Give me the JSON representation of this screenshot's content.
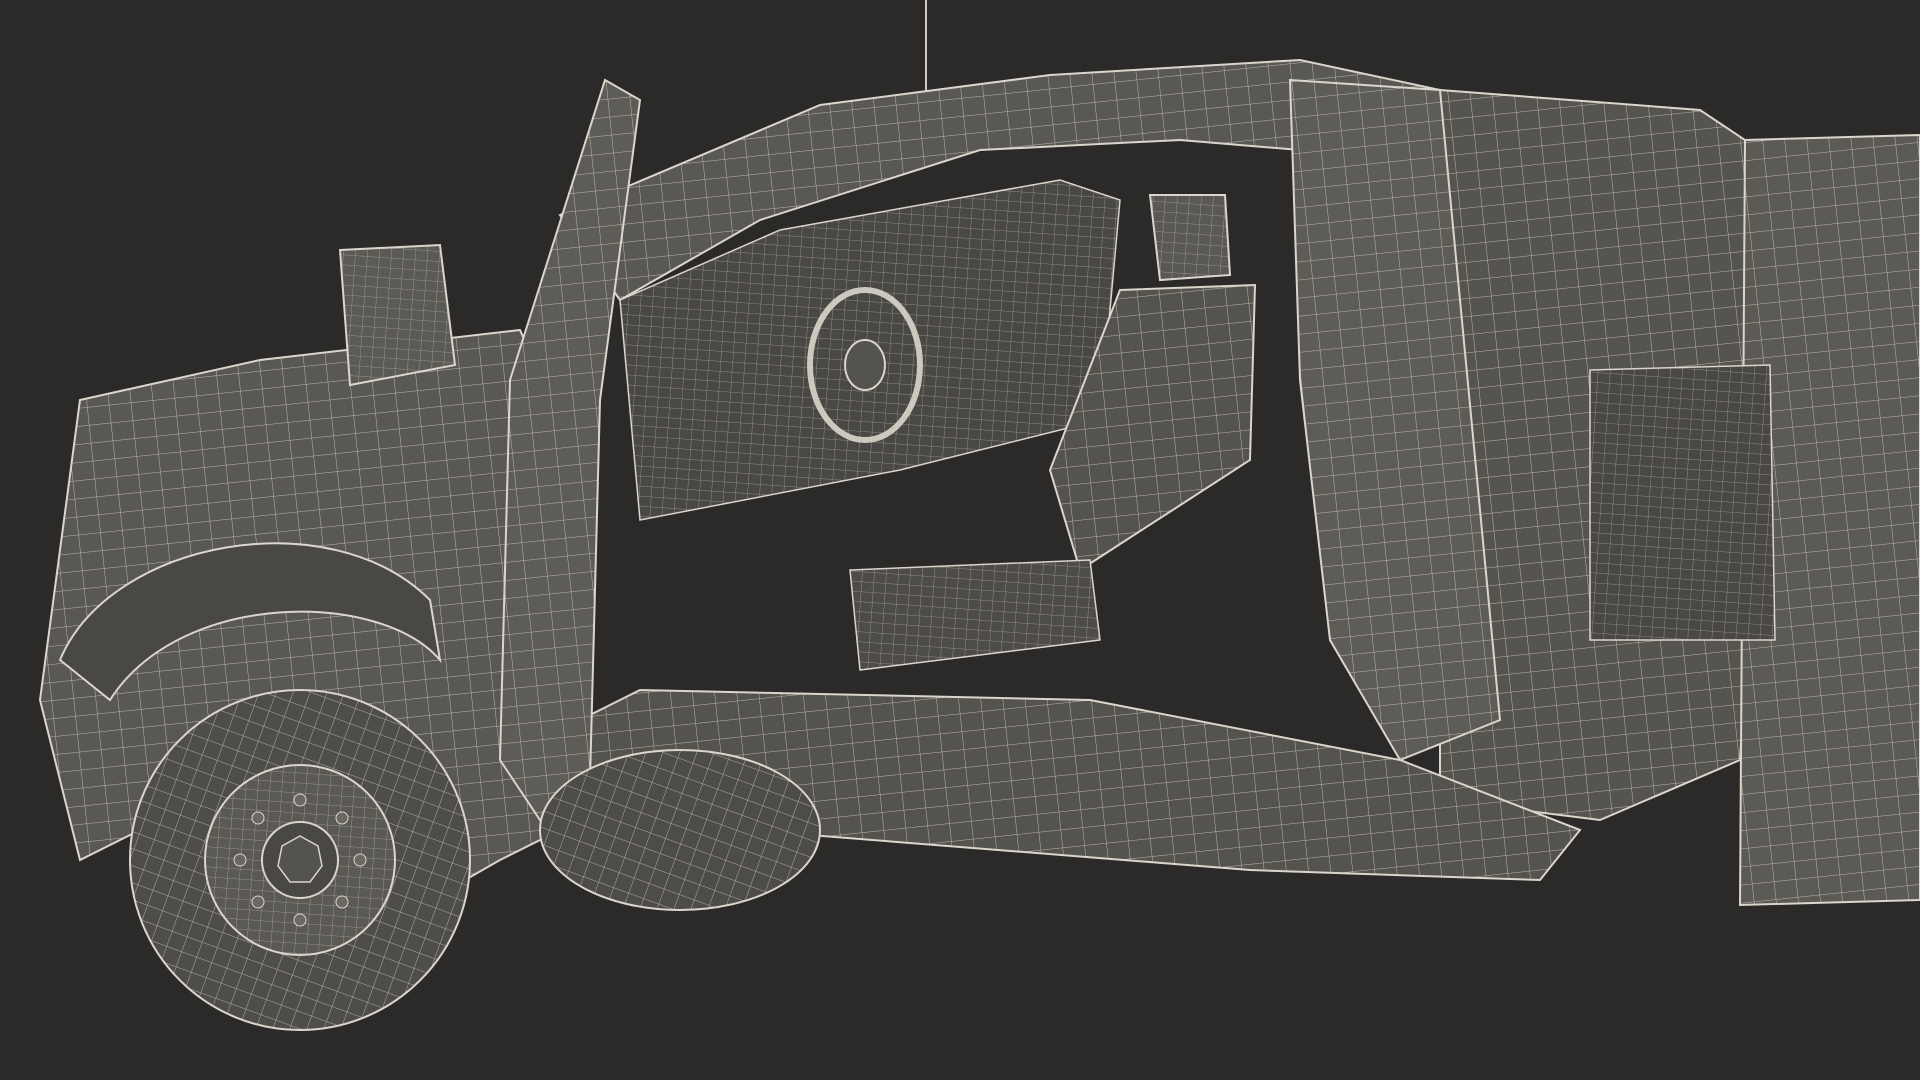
{
  "scene": {
    "subject": "pickup-truck-wireframe",
    "render_style": "wireframe",
    "background_color": "#2b2a29",
    "surface_color": "#5a5854",
    "surface_dark_color": "#45433f",
    "wire_color": "#d9d6cc",
    "cab_door_state": "open"
  }
}
